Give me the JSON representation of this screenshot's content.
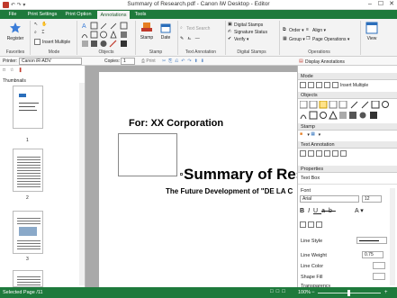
{
  "window": {
    "title": "Summary of Research.pdf - Canon iW Desktop - Editor",
    "controls": [
      "–",
      "☐",
      "✕"
    ]
  },
  "menu": {
    "tabs": [
      "File",
      "Print Settings",
      "Print Option",
      "Annotations",
      "Tools"
    ]
  },
  "ribbon": {
    "register": "Register",
    "insert_multiple": "Insert Multiple",
    "stamp": "Stamp",
    "date": "Date",
    "text_search": "Text Search",
    "digital_stamps": "Digital Stamps",
    "signature_status": "Signature Status",
    "verify": "Verify",
    "order": "Order",
    "group": "Group",
    "align": "Align",
    "page_operations": "Page Operations",
    "view": "View",
    "groups": [
      "Favorites",
      "Mode",
      "Objects",
      "Stamp",
      "Text Annotation",
      "Digital Stamps",
      "Operations"
    ]
  },
  "toolbar2": {
    "printer_label": "Printer:",
    "printer_value": "Canon iR-ADV",
    "copies_label": "Copies:",
    "copies_value": "1",
    "print_label": "Print",
    "display_annotations": "Display Annotations"
  },
  "left_pane": {
    "title": "Thumbnails",
    "pages": [
      "1",
      "2",
      "3"
    ]
  },
  "document": {
    "for_text": "For: XX Corporation",
    "heading": "Summary of Rese",
    "subheading": "The Future Development of \"DE LA C"
  },
  "right_pane": {
    "mode_title": "Mode",
    "insert_multiple": "Insert Multiple",
    "objects_title": "Objects",
    "stamp_title": "Stamp",
    "text_annotation_title": "Text Annotation",
    "properties_title": "Properties",
    "properties_subtitle": "Text Box",
    "font_label": "Font",
    "font_name": "Arial",
    "font_size": "12",
    "line_style_label": "Line Style",
    "line_weight_label": "Line Weight",
    "line_weight_value": "0.75",
    "line_color_label": "Line Color",
    "shape_fill_label": "Shape Fill",
    "transparency_label": "Transparency"
  },
  "status": {
    "selected_page": "Selected Page",
    "page_of": "/11",
    "zoom": "100%"
  },
  "colors": {
    "brand_green": "#1e7a3c",
    "ribbon_bg": "#f3f3f3",
    "viewer_bg": "#a9a9a9"
  }
}
